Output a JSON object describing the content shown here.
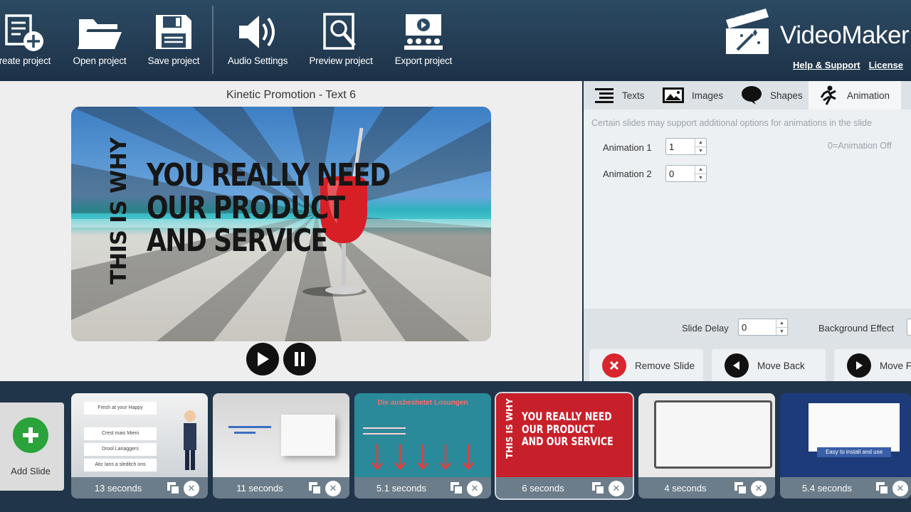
{
  "toolbar": {
    "buttons": [
      {
        "label": "reate project",
        "icon": "new-project-icon"
      },
      {
        "label": "Open project",
        "icon": "folder-icon"
      },
      {
        "label": "Save project",
        "icon": "floppy-disk-icon"
      },
      {
        "label": "Audio Settings",
        "icon": "speaker-icon"
      },
      {
        "label": "Preview project",
        "icon": "magnifier-icon"
      },
      {
        "label": "Export project",
        "icon": "presentation-icon"
      }
    ],
    "brand": "VideoMaker",
    "links": {
      "help": "Help & Support",
      "license": "License"
    }
  },
  "preview": {
    "title": "Kinetic Promotion - Text  6",
    "vertical_text": "THIS IS WHY",
    "lines": [
      "YOU REALLY NEED",
      "OUR PRODUCT",
      "AND SERVICE"
    ]
  },
  "panel": {
    "tabs": [
      {
        "label": "Texts",
        "icon": "text-lines-icon"
      },
      {
        "label": "Images",
        "icon": "image-icon"
      },
      {
        "label": "Shapes",
        "icon": "speech-bubble-icon"
      },
      {
        "label": "Animation",
        "icon": "running-figure-icon",
        "active": true
      }
    ],
    "note": "Certain slides may support additional options for animations in the slide",
    "animation1": {
      "label": "Animation 1",
      "value": "1"
    },
    "animation2": {
      "label": "Animation 2",
      "value": "0"
    },
    "animation_off_hint": "0=Animation Off",
    "slide_delay": {
      "label": "Slide Delay",
      "value": "0"
    },
    "background_effect": {
      "label": "Background Effect"
    },
    "actions": {
      "remove": "Remove Slide",
      "move_back": "Move Back",
      "move_forward": "Move Fo"
    }
  },
  "timeline": {
    "add_slide": "Add Slide",
    "slides": [
      {
        "duration": "13 seconds"
      },
      {
        "duration": "11 seconds"
      },
      {
        "duration": "5.1 seconds"
      },
      {
        "duration": "6 seconds",
        "selected": true
      },
      {
        "duration": "4 seconds"
      },
      {
        "duration": "5.4 seconds"
      }
    ],
    "thumb1_items": [
      "Fresh at your Happy",
      "Crest mais Mieni",
      "Drool Lanaggers",
      "Atic lans a sleditch ons"
    ],
    "thumb3_title": "Die ausbeshetet Losungen",
    "thumb4_lines": [
      "YOU REALLY NEED",
      "OUR PRODUCT",
      "AND OUR SERVICE"
    ],
    "thumb4_vertical": "THIS IS WHY",
    "thumb6_caption": "Easy to install and use"
  },
  "colors": {
    "accent_green": "#29a33a",
    "remove_red": "#d9262e",
    "selected_thumb": "#c8202a",
    "toolbar": "#2c4a63"
  }
}
